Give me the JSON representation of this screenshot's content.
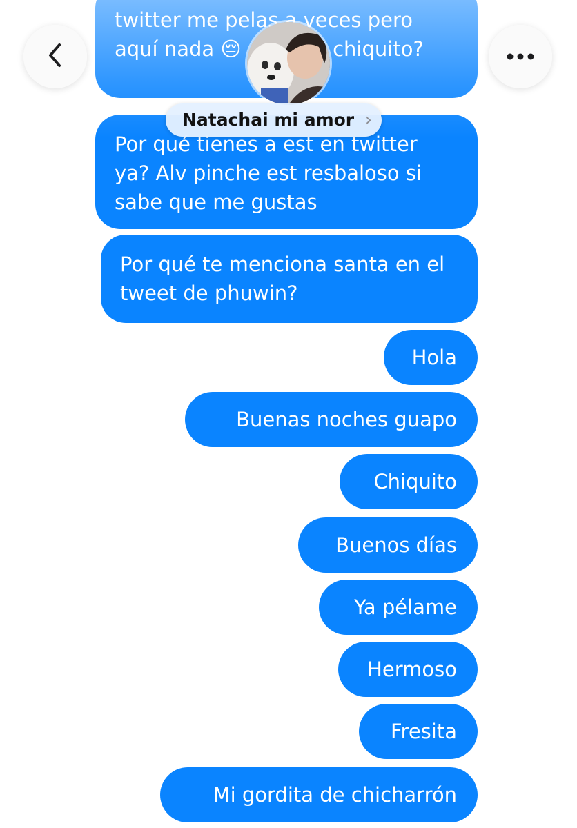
{
  "header": {
    "contact_name": "Natachai mi amor",
    "chevron": "›",
    "back_icon": "chevron-left-icon",
    "more_icon": "ellipsis-icon",
    "avatar": "contact-avatar-photo"
  },
  "messages": [
    {
      "text": "twitter me pelas a veces pero aquí nada 😔 ¿te hice chiquito?"
    },
    {
      "text": "Por qué tienes a est en twitter ya? Alv pinche est resbaloso si sabe que me gustas"
    },
    {
      "text": "Por qué te menciona santa en el tweet de phuwin?"
    },
    {
      "text": "Hola"
    },
    {
      "text": "Buenas noches guapo"
    },
    {
      "text": "Chiquito"
    },
    {
      "text": "Buenos días"
    },
    {
      "text": "Ya pélame"
    },
    {
      "text": "Hermoso"
    },
    {
      "text": "Fresita"
    },
    {
      "text": "Mi gordita de chicharrón"
    }
  ],
  "colors": {
    "bubble": "#0a84ff",
    "bubble_text": "#ffffff",
    "background": "#ffffff"
  }
}
